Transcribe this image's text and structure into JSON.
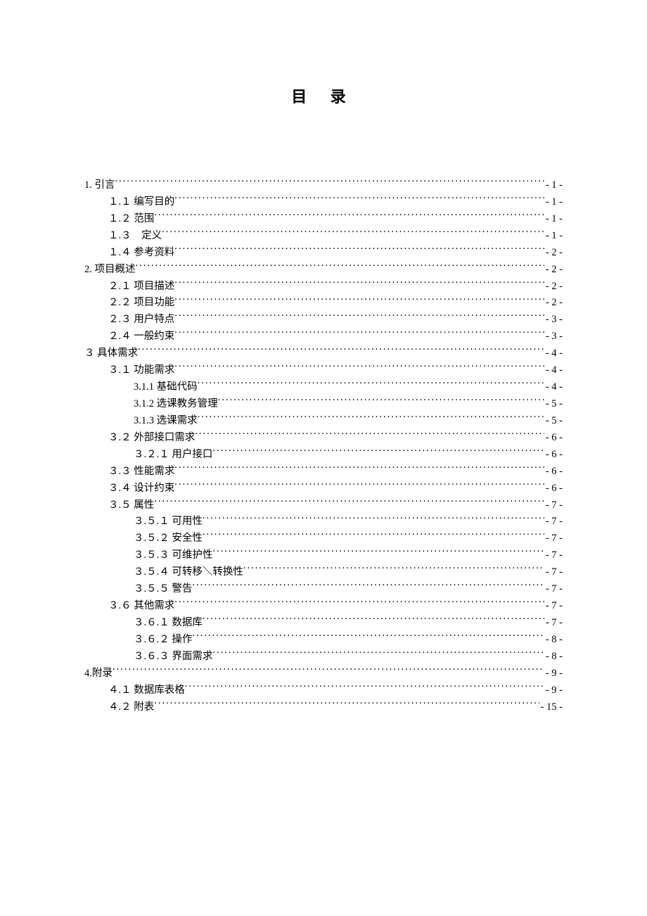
{
  "title": "目 录",
  "toc": [
    {
      "level": 0,
      "label": "1. 引言",
      "page": "- 1 -"
    },
    {
      "level": 1,
      "label": "１.１ 编写目的",
      "page": "- 1 -"
    },
    {
      "level": 1,
      "label": "１.２ 范围",
      "page": "- 1 -"
    },
    {
      "level": 1,
      "label": "１.３　定义",
      "page": "- 1 -"
    },
    {
      "level": 1,
      "label": "１.４ 参考资料",
      "page": "- 2 -"
    },
    {
      "level": 0,
      "label": "2. 项目概述",
      "page": "- 2 -"
    },
    {
      "level": 1,
      "label": "２.１ 项目描述",
      "page": "- 2 -"
    },
    {
      "level": 1,
      "label": "２.２ 项目功能",
      "page": "- 2 -"
    },
    {
      "level": 1,
      "label": "２.３ 用户特点",
      "page": "- 3 -"
    },
    {
      "level": 1,
      "label": "２.４ 一般约束",
      "page": "- 3 -"
    },
    {
      "level": 0,
      "label": "３ 具体需求",
      "page": "- 4 -"
    },
    {
      "level": 1,
      "label": "３.１ 功能需求",
      "page": "- 4 -"
    },
    {
      "level": 2,
      "label": "3.1.1  基础代码",
      "page": "- 4 -"
    },
    {
      "level": 2,
      "label": "3.1.2  选课教务管理",
      "page": "- 5 -"
    },
    {
      "level": 2,
      "label": "3.1.3  选课需求",
      "page": "- 5 -"
    },
    {
      "level": 1,
      "label": "３.２ 外部接口需求",
      "page": "- 6 -"
    },
    {
      "level": 2,
      "label": "３.２.１ 用户接口",
      "page": "- 6 -"
    },
    {
      "level": 1,
      "label": "３.３ 性能需求",
      "page": "- 6 -"
    },
    {
      "level": 1,
      "label": "３.４ 设计约束",
      "page": "- 6 -"
    },
    {
      "level": 1,
      "label": "３.５ 属性",
      "page": "- 7 -"
    },
    {
      "level": 2,
      "label": "３.５.１ 可用性",
      "page": "- 7 -"
    },
    {
      "level": 2,
      "label": "３.５.２ 安全性",
      "page": "- 7 -"
    },
    {
      "level": 2,
      "label": "３.５.３ 可维护性",
      "page": "- 7 -"
    },
    {
      "level": 2,
      "label": "３.５.４ 可转移＼转换性",
      "page": "- 7 -"
    },
    {
      "level": 2,
      "label": "３.５.５ 警告",
      "page": "- 7 -"
    },
    {
      "level": 1,
      "label": "３.６ 其他需求",
      "page": "- 7 -"
    },
    {
      "level": 2,
      "label": "３.６.１ 数据库",
      "page": "- 7 -"
    },
    {
      "level": 2,
      "label": "３.６.２ 操作",
      "page": "- 8 -"
    },
    {
      "level": 2,
      "label": "３.６.３ 界面需求",
      "page": "- 8 -"
    },
    {
      "level": 0,
      "label": "4.附录",
      "page": "- 9 -"
    },
    {
      "level": 1,
      "label": "４.１ 数据库表格",
      "page": "- 9 -"
    },
    {
      "level": 1,
      "label": "４.２ 附表",
      "page": "- 15 -"
    }
  ]
}
